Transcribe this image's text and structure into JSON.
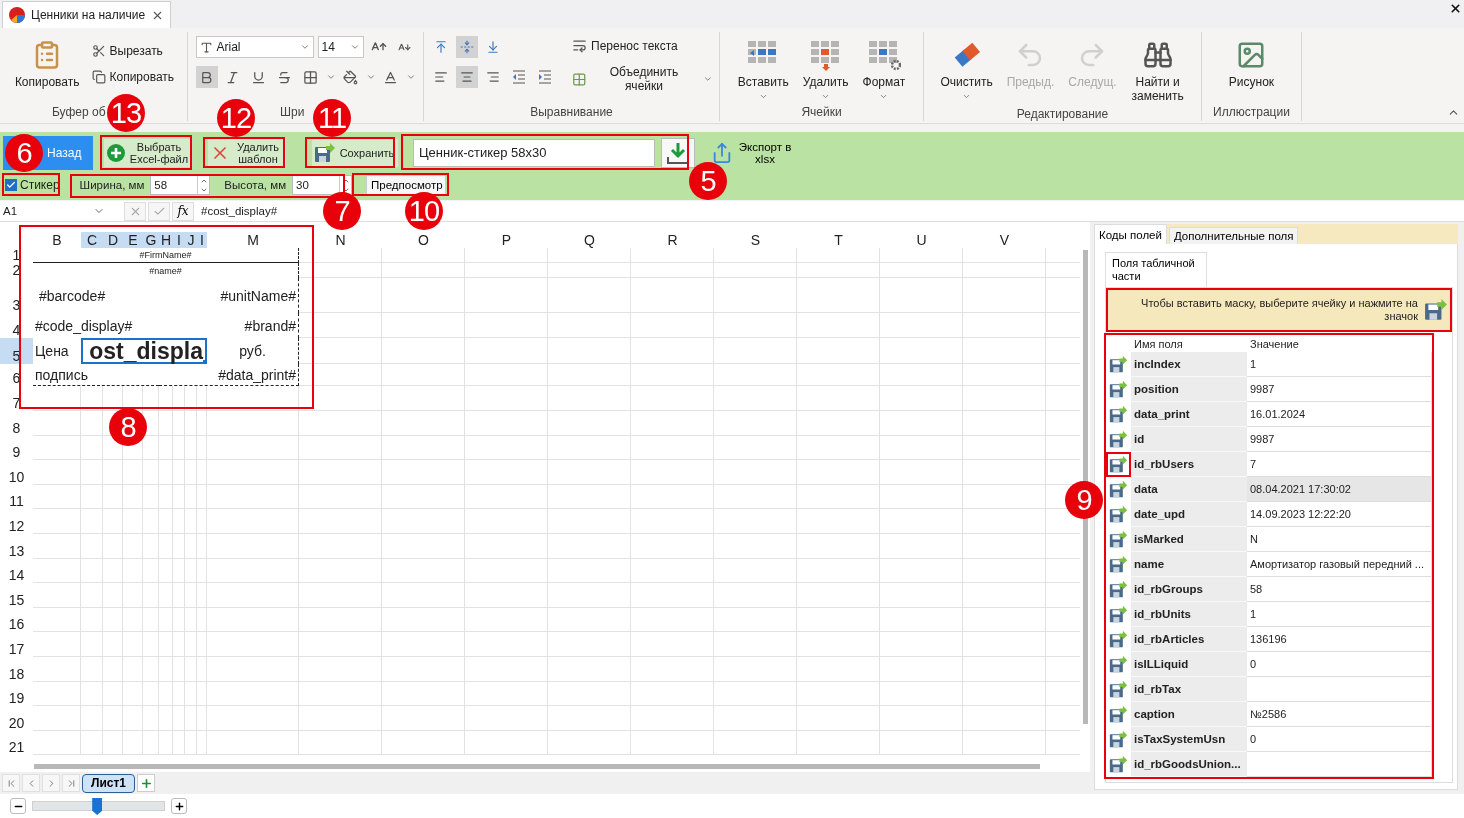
{
  "window": {
    "tab_title": "Ценники на наличие"
  },
  "ribbon": {
    "clipboard": {
      "label": "Буфер об",
      "paste": "Копировать",
      "cut": "Вырезать",
      "copy": "Копировать"
    },
    "font": {
      "label": "Шри",
      "family": "Arial",
      "size": "14",
      "styles": [
        {
          "selected": true
        },
        {
          "selected": false
        },
        {
          "selected": false
        },
        {
          "selected": false
        }
      ]
    },
    "alignment": {
      "label": "Выравнивание",
      "vertical": [
        {
          "selected": false
        },
        {
          "selected": true
        },
        {
          "selected": false
        }
      ],
      "horizontal": [
        {
          "selected": false
        },
        {
          "selected": true
        },
        {
          "selected": false
        }
      ],
      "wrap_text": "Перенос текста",
      "merge_cells": "Объединить ячейки"
    },
    "cells": {
      "label": "Ячейки",
      "buttons": [
        "Вставить",
        "Удалить",
        "Формат"
      ]
    },
    "editing": {
      "label": "Редактирование",
      "buttons": [
        {
          "label": "Очистить",
          "disabled": false
        },
        {
          "label": "Предыд.",
          "disabled": true
        },
        {
          "label": "Следущ.",
          "disabled": true
        },
        {
          "label": "Найти и заменить",
          "disabled": false
        }
      ]
    },
    "illustrations": {
      "label": "Иллюстрации",
      "buttons": [
        "Рисунок"
      ]
    }
  },
  "toolbar": {
    "back": "Назад",
    "choose_file": "Выбрать Excel-файл",
    "delete_template": "Удалить шаблон",
    "save": "Сохранить",
    "template": "Ценник-стикер 58x30",
    "export": "Экспорт в xlsx",
    "sticker": {
      "label": "Стикер",
      "checked": true
    },
    "width": {
      "label": "Ширина, мм",
      "value": "58"
    },
    "height": {
      "label": "Высота, мм",
      "value": "30"
    },
    "preview": "Предпосмотр"
  },
  "formula_bar": {
    "cell_ref": "A1",
    "function_button": "fx",
    "formula": "#cost_display#"
  },
  "sheet": {
    "columns": [
      {
        "label": "B",
        "selected": false
      },
      {
        "label": "C",
        "selected": true
      },
      {
        "label": "D",
        "selected": true
      },
      {
        "label": "E",
        "selected": true
      },
      {
        "label": "G",
        "selected": true
      },
      {
        "label": "H",
        "selected": true
      },
      {
        "label": "I",
        "selected": true
      },
      {
        "label": "J",
        "selected": true
      },
      {
        "label": "I",
        "selected": true
      },
      {
        "label": "M",
        "selected": false
      },
      {
        "label": "N",
        "selected": false
      },
      {
        "label": "O",
        "selected": false
      },
      {
        "label": "P",
        "selected": false
      },
      {
        "label": "Q",
        "selected": false
      },
      {
        "label": "R",
        "selected": false
      },
      {
        "label": "S",
        "selected": false
      },
      {
        "label": "T",
        "selected": false
      },
      {
        "label": "U",
        "selected": false
      },
      {
        "label": "V",
        "selected": false
      }
    ],
    "rows": [
      {
        "label": "1",
        "selected": false
      },
      {
        "label": "2",
        "selected": false
      },
      {
        "label": "3",
        "selected": false
      },
      {
        "label": "4",
        "selected": false
      },
      {
        "label": "5",
        "selected": true
      },
      {
        "label": "6",
        "selected": false
      },
      {
        "label": "7",
        "selected": false
      },
      {
        "label": "8",
        "selected": false
      },
      {
        "label": "9",
        "selected": false
      },
      {
        "label": "10",
        "selected": false
      },
      {
        "label": "11",
        "selected": false
      },
      {
        "label": "12",
        "selected": false
      },
      {
        "label": "13",
        "selected": false
      },
      {
        "label": "14",
        "selected": false
      },
      {
        "label": "15",
        "selected": false
      },
      {
        "label": "16",
        "selected": false
      },
      {
        "label": "17",
        "selected": false
      },
      {
        "label": "18",
        "selected": false
      },
      {
        "label": "19",
        "selected": false
      },
      {
        "label": "20",
        "selected": false
      },
      {
        "label": "21",
        "selected": false
      }
    ],
    "template": {
      "firm_name": "#FirmName#",
      "name": "#name#",
      "barcode": "#barcode#",
      "unit_name": "#unitName#",
      "code_display": "#code_display#",
      "brand": "#brand#",
      "price_label": "Цена",
      "cost_display": "ost_displa",
      "currency": "руб.",
      "signature": "подпись",
      "date_print": "#data_print#"
    }
  },
  "sheet_tabs": [
    {
      "label": "Лист1",
      "selected": true
    }
  ],
  "fields_panel": {
    "tabs": [
      {
        "label": "Коды полей",
        "selected": true
      },
      {
        "label": "Дополнительные поля",
        "selected": false
      }
    ],
    "subtab": "Поля табличной части",
    "hint": "Чтобы вставить маску, выберите ячейку и нажмите на значок",
    "columns": [
      "Имя поля",
      "Значение"
    ],
    "rows": [
      {
        "name": "incIndex",
        "value": "1",
        "selected": false,
        "highlighted": false
      },
      {
        "name": "position",
        "value": "9987",
        "selected": false,
        "highlighted": false
      },
      {
        "name": "data_print",
        "value": "16.01.2024",
        "selected": false,
        "highlighted": false
      },
      {
        "name": "id",
        "value": "9987",
        "selected": false,
        "highlighted": false
      },
      {
        "name": "id_rbUsers",
        "value": "7",
        "selected": false,
        "highlighted": true
      },
      {
        "name": "data",
        "value": "08.04.2021 17:30:02",
        "selected": true,
        "highlighted": false
      },
      {
        "name": "date_upd",
        "value": "14.09.2023 12:22:20",
        "selected": false,
        "highlighted": false
      },
      {
        "name": "isMarked",
        "value": "N",
        "selected": false,
        "highlighted": false
      },
      {
        "name": "name",
        "value": "Амортизатор газовый передний ...",
        "selected": false,
        "highlighted": false
      },
      {
        "name": "id_rbGroups",
        "value": "58",
        "selected": false,
        "highlighted": false
      },
      {
        "name": "id_rbUnits",
        "value": "1",
        "selected": false,
        "highlighted": false
      },
      {
        "name": "id_rbArticles",
        "value": "136196",
        "selected": false,
        "highlighted": false
      },
      {
        "name": "isILLiquid",
        "value": "0",
        "selected": false,
        "highlighted": false
      },
      {
        "name": "id_rbTax",
        "selected": false,
        "highlighted": false
      },
      {
        "name": "caption",
        "value": "№2586",
        "selected": false,
        "highlighted": false
      },
      {
        "name": "isTaxSystemUsn",
        "value": "0",
        "selected": false,
        "highlighted": false
      },
      {
        "name": "id_rbGoodsUnion...",
        "selected": false,
        "highlighted": false
      }
    ]
  },
  "zoom": {
    "level": 0.49
  },
  "callouts": [
    "13",
    "12",
    "11",
    "6",
    "5",
    "7",
    "10",
    "8",
    "9"
  ]
}
